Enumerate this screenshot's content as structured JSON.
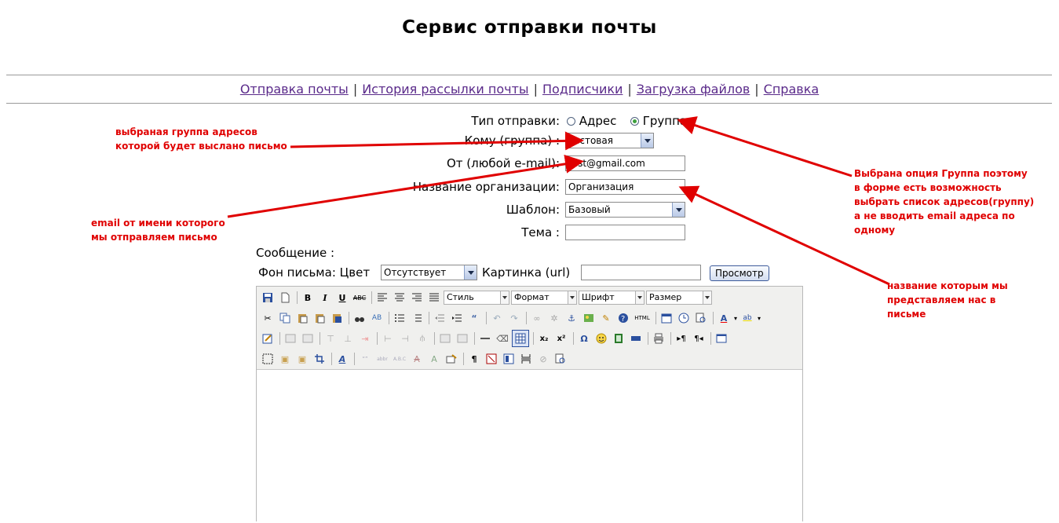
{
  "page_title": "Сервис отправки почты",
  "nav": {
    "items": [
      "Отправка почты",
      "История рассылки почты",
      "Подписчики",
      "Загрузка файлов",
      "Справка"
    ],
    "separator": "|"
  },
  "form": {
    "send_type_label": "Тип отправки:",
    "send_type_options": [
      "Адрес",
      "Группа"
    ],
    "send_type_selected": "Группа",
    "to_group_label": "Кому (группа) :",
    "to_group_value": "тестовая",
    "from_label": "От (любой e-mail):",
    "from_value": "test@gmail.com",
    "org_label": "Название организации:",
    "org_value": "Организация",
    "template_label": "Шаблон:",
    "template_value": "Базовый",
    "subject_label": "Тема :",
    "subject_value": "",
    "message_label": "Сообщение :",
    "bg_label": "Фон письма: Цвет",
    "bg_color_value": "Отсутствует",
    "picture_label": "Картинка (url)",
    "picture_value": "",
    "preview_button": "Просмотр"
  },
  "editor": {
    "style_select": "Стиль",
    "format_select": "Формат",
    "font_select": "Шрифт",
    "size_select": "Размер",
    "html_button": "HTML"
  },
  "annotations": {
    "group_note": [
      "выбраная группа адресов",
      "которой будет выслано письмо"
    ],
    "email_note": [
      "email от имени которого",
      "мы отправляем письмо"
    ],
    "option_note": [
      "Выбрана опция Группа поэтому",
      "в форме есть возможность",
      "выбрать список адресов(группу)",
      "а не вводить email адреса по",
      "одному"
    ],
    "org_note": [
      "название которым мы",
      "представляем нас в",
      "письме"
    ]
  },
  "colors": {
    "annotation": "#ff0000",
    "link": "#5a2a8a"
  }
}
